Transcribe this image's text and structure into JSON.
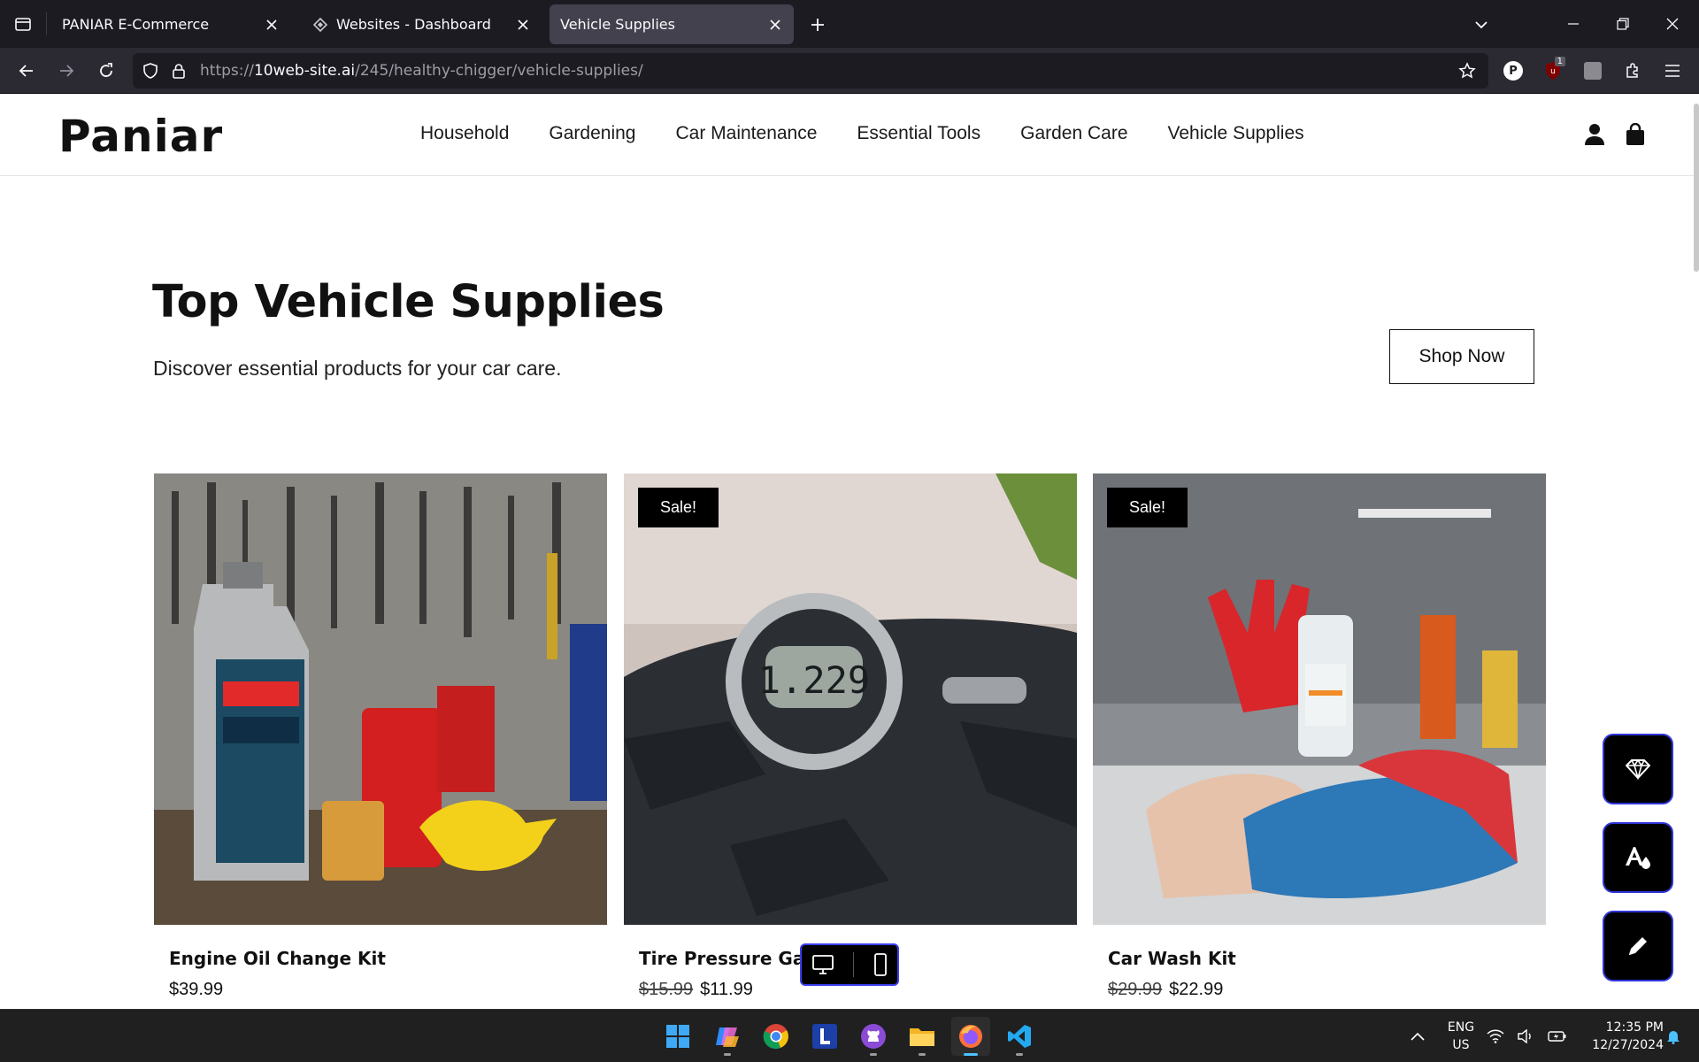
{
  "browser": {
    "tabs": [
      {
        "title": "PANIAR E-Commerce",
        "active": false
      },
      {
        "title": "Websites - Dashboard",
        "active": false
      },
      {
        "title": "Vehicle Supplies",
        "active": true
      }
    ],
    "url_prefix": "https://",
    "url_host": "10web-site.ai",
    "url_path": "/245/healthy-chigger/vehicle-supplies/",
    "extension_badge": "1",
    "profile_initial": "P"
  },
  "site": {
    "logo": "Paniar",
    "nav": [
      "Household",
      "Gardening",
      "Car Maintenance",
      "Essential Tools",
      "Garden Care",
      "Vehicle Supplies"
    ]
  },
  "hero": {
    "title": "Top Vehicle Supplies",
    "subtitle": "Discover essential products for your car care.",
    "cta": "Shop Now"
  },
  "products": [
    {
      "name": "Engine Oil Change Kit",
      "price": "$39.99",
      "old_price": "",
      "sale": false
    },
    {
      "name": "Tire Pressure Gau",
      "price": "$11.99",
      "old_price": "$15.99",
      "sale": true,
      "sale_label": "Sale!"
    },
    {
      "name": "Car Wash Kit",
      "price": "$22.99",
      "old_price": "$29.99",
      "sale": true,
      "sale_label": "Sale!"
    }
  ],
  "taskbar": {
    "lang_line1": "ENG",
    "lang_line2": "US",
    "time": "12:35 PM",
    "date": "12/27/2024"
  },
  "colors": {
    "accent_border": "#2f35d9",
    "active_tab_indicator": "#4cc2ff"
  }
}
